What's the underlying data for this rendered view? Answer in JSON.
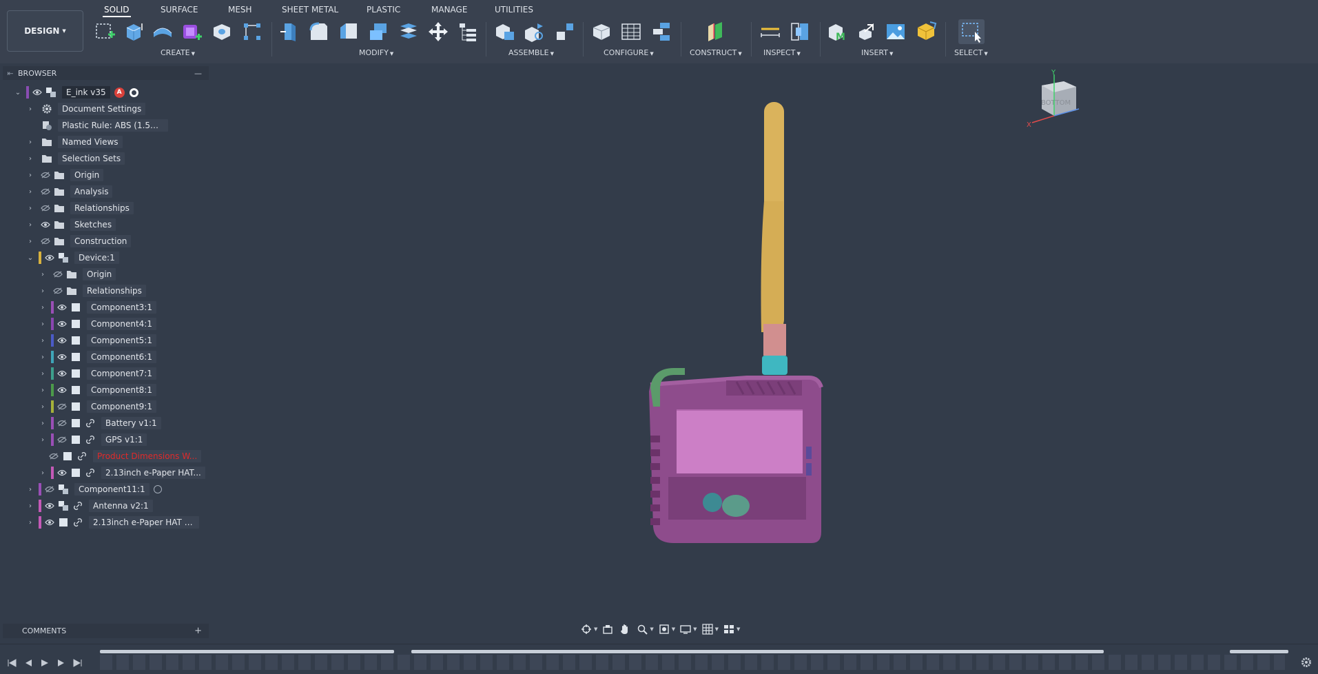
{
  "workspace": {
    "label": "DESIGN"
  },
  "tabs": [
    {
      "label": "SOLID",
      "active": true
    },
    {
      "label": "SURFACE"
    },
    {
      "label": "MESH"
    },
    {
      "label": "SHEET METAL"
    },
    {
      "label": "PLASTIC"
    },
    {
      "label": "MANAGE"
    },
    {
      "label": "UTILITIES"
    }
  ],
  "groups": {
    "create": "CREATE",
    "modify": "MODIFY",
    "assemble": "ASSEMBLE",
    "configure": "CONFIGURE",
    "construct": "CONSTRUCT",
    "inspect": "INSPECT",
    "insert": "INSERT",
    "select": "SELECT"
  },
  "browser": {
    "title": "BROWSER",
    "root": {
      "label": "E_ink v35",
      "badge": "A"
    },
    "items": [
      {
        "label": "Document Settings",
        "icon": "gear-icon"
      },
      {
        "label": "Plastic Rule: ABS (1.5mm)",
        "icon": "plastic-rule-icon"
      },
      {
        "label": "Named Views",
        "icon": "folder-icon"
      },
      {
        "label": "Selection Sets",
        "icon": "folder-icon"
      },
      {
        "label": "Origin",
        "icon": "folder-icon",
        "visible": false
      },
      {
        "label": "Analysis",
        "icon": "folder-icon",
        "visible": false
      },
      {
        "label": "Relationships",
        "icon": "folder-icon",
        "visible": false
      },
      {
        "label": "Sketches",
        "icon": "folder-icon",
        "visible": true
      },
      {
        "label": "Construction",
        "icon": "folder-icon",
        "visible": false
      },
      {
        "label": "Device:1",
        "icon": "assembly-icon",
        "visible": true,
        "color": "#d8b23f"
      },
      {
        "label": "Origin",
        "icon": "folder-icon",
        "visible": false
      },
      {
        "label": "Relationships",
        "icon": "folder-icon",
        "visible": false
      },
      {
        "label": "Component3:1",
        "icon": "component-icon",
        "visible": true,
        "color": "#9a4fb6"
      },
      {
        "label": "Component4:1",
        "icon": "component-icon",
        "visible": true,
        "color": "#8a46b0"
      },
      {
        "label": "Component5:1",
        "icon": "component-icon",
        "visible": true,
        "color": "#4b5bc7"
      },
      {
        "label": "Component6:1",
        "icon": "component-icon",
        "visible": true,
        "color": "#3fa5b8"
      },
      {
        "label": "Component7:1",
        "icon": "component-icon",
        "visible": true,
        "color": "#3d9f8c"
      },
      {
        "label": "Component8:1",
        "icon": "component-icon",
        "visible": true,
        "color": "#4c9a4a"
      },
      {
        "label": "Component9:1",
        "icon": "component-icon",
        "visible": false,
        "color": "#a5b13a"
      },
      {
        "label": "Battery v1:1",
        "icon": "component-icon",
        "visible": false,
        "color": "#9a4fb6",
        "linked": true
      },
      {
        "label": "GPS v1:1",
        "icon": "component-icon",
        "visible": false,
        "color": "#9a4fb6",
        "linked": true
      },
      {
        "label": "Product Dimensions W...",
        "icon": "component-icon",
        "visible": false,
        "linked": true,
        "error": true
      },
      {
        "label": "2.13inch e-Paper HAT...",
        "icon": "component-icon",
        "visible": true,
        "color": "#c45ab7",
        "linked": true
      },
      {
        "label": "Component11:1",
        "icon": "assembly-icon",
        "visible": false,
        "color": "#9a4fb6"
      },
      {
        "label": "Antenna v2:1",
        "icon": "assembly-icon",
        "visible": true,
        "color": "#c45ab7",
        "linked": true
      },
      {
        "label": "2.13inch e-Paper HAT bw...",
        "icon": "component-icon",
        "visible": true,
        "color": "#c45ab7",
        "linked": true
      }
    ]
  },
  "comments": {
    "label": "COMMENTS"
  },
  "viewcube": {
    "face": "BOTTOM",
    "axis_y": "Y",
    "axis_x": "X"
  },
  "colors": {
    "antenna": "#dab35c",
    "antenna_joint": "#d18f8f",
    "connector": "#3fb7c1",
    "housing": "#8e4c8c",
    "screen": "#cc7fc6",
    "handle": "#5b9b6a"
  }
}
